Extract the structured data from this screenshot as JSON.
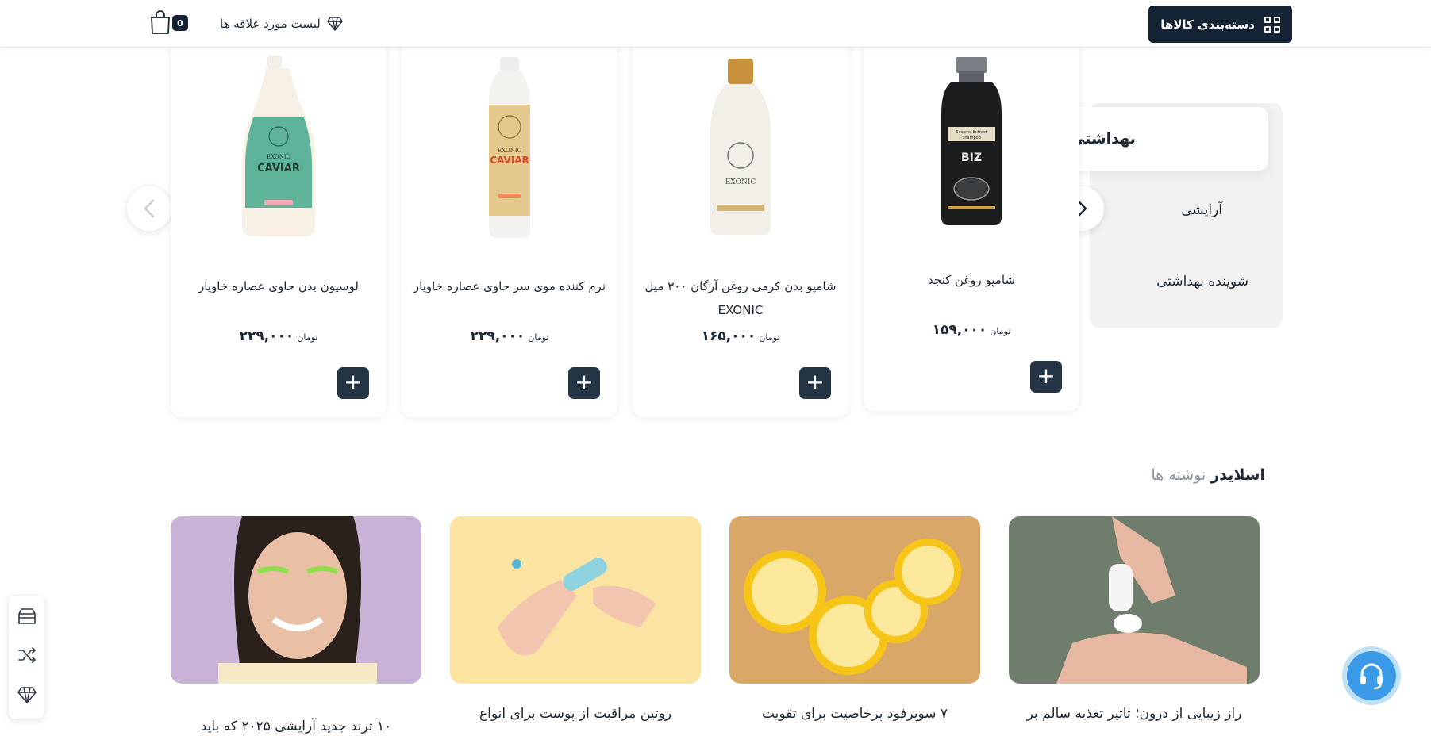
{
  "header": {
    "categories_label": "دسته‌بندی کالاها",
    "wishlist_label": "لیست مورد علاقه ها",
    "cart_count": "0"
  },
  "tabs": [
    {
      "label": "بهداشتی",
      "active": true
    },
    {
      "label": "آرایشی",
      "active": false
    },
    {
      "label": "شوینده بهداشتی",
      "active": false
    }
  ],
  "products": [
    {
      "name": "شامپو روغن کنجد",
      "price": "۱۵۹,۰۰۰",
      "currency": "تومان",
      "icon": "black-shampoo-bottle"
    },
    {
      "name": "شامپو بدن کرمی روغن آرگان ۳۰۰ میل EXONIC",
      "price": "۱۶۵,۰۰۰",
      "currency": "تومان",
      "icon": "white-bottle-gold-cap"
    },
    {
      "name": "نرم کننده موی سر حاوی عصاره خاویار",
      "price": "۲۲۹,۰۰۰",
      "currency": "تومان",
      "icon": "gold-label-bottle"
    },
    {
      "name": "لوسیون بدن حاوی عصاره خاویار",
      "price": "۲۲۹,۰۰۰",
      "currency": "تومان",
      "icon": "green-label-lotion"
    }
  ],
  "product_labels": {
    "p1": [
      "Sesame Extract",
      "Shampoo",
      "BIZ"
    ],
    "p2": [
      "EXONIC"
    ],
    "p3": [
      "EXONIC",
      "CAVIAR"
    ],
    "p4": [
      "EXONIC",
      "CAVIAR"
    ]
  },
  "blog_section": {
    "title_bold": "اسلایدر",
    "title_rest": "نوشته ها",
    "posts": [
      {
        "title": "راز زیبایی از درون؛ تاثیر تغذیه سالم بر"
      },
      {
        "title": "۷ سوپرفود پرخاصیت برای تقویت"
      },
      {
        "title": "روتین مراقبت از پوست برای انواع"
      },
      {
        "title": "۱۰ ترند جدید آرایشی ۲۰۲۵ که باید"
      }
    ]
  },
  "colors": {
    "primary": "#142434",
    "button": "#233444",
    "support": "#3a9ae8"
  }
}
